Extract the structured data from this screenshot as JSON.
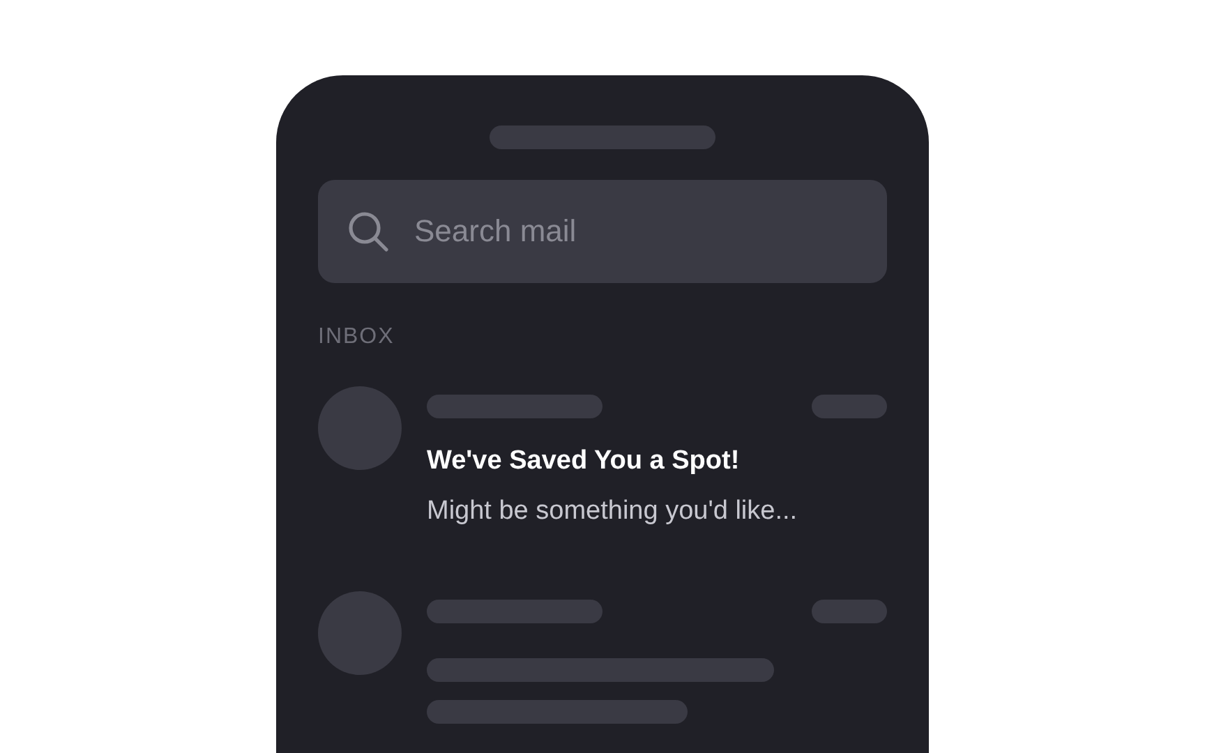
{
  "search": {
    "placeholder": "Search mail"
  },
  "section_label": "INBOX",
  "messages": [
    {
      "kind": "message",
      "title": "We've Saved You a Spot!",
      "preview": "Might be something you'd like..."
    },
    {
      "kind": "loading"
    }
  ]
}
